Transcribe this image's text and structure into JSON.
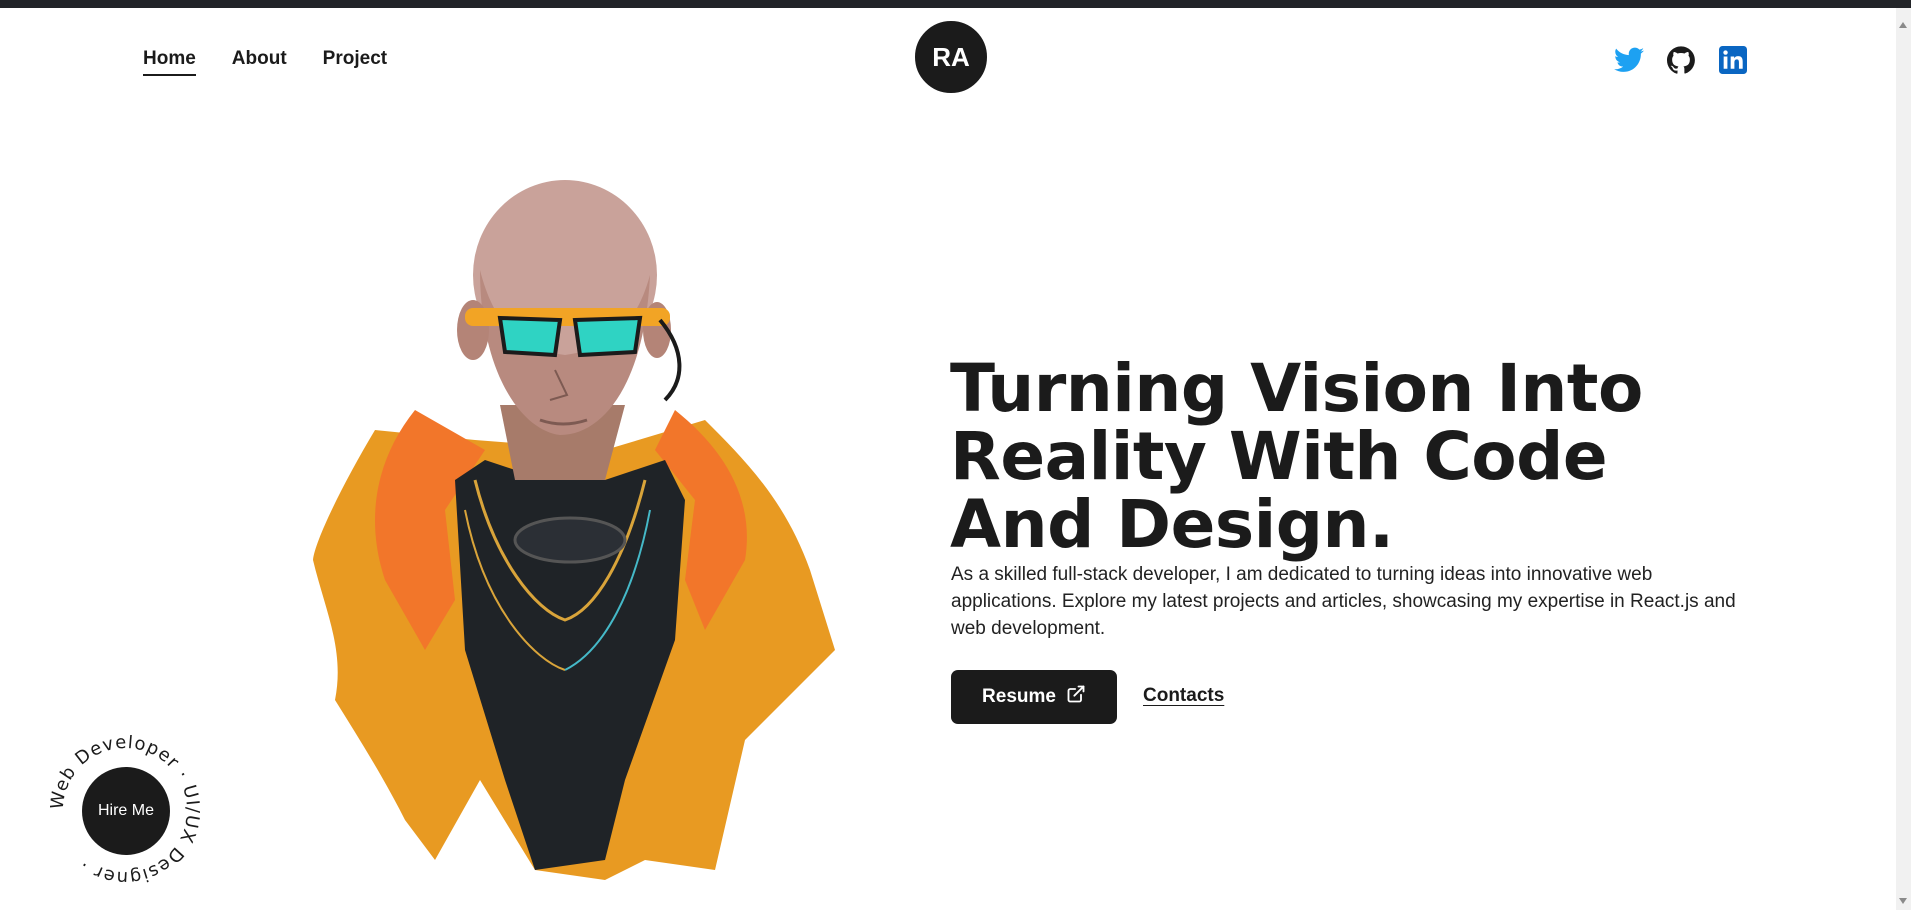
{
  "nav": {
    "items": [
      {
        "label": "Home",
        "active": true
      },
      {
        "label": "About",
        "active": false
      },
      {
        "label": "Project",
        "active": false
      }
    ]
  },
  "logo": {
    "initials": "RA"
  },
  "socials": {
    "icons": [
      "twitter-icon",
      "github-icon",
      "linkedin-icon"
    ],
    "colors": {
      "twitter": "#1DA1F2",
      "github": "#1b1b1b",
      "linkedin": "#0A66C2"
    }
  },
  "hero": {
    "headline_lines": [
      "Turning Vision Into",
      "Reality With Code",
      "And Design."
    ],
    "description": "As a skilled full-stack developer, I am dedicated to turning ideas into innovative web applications. Explore my latest projects and articles, showcasing my expertise in React.js and web development.",
    "resume_label": "Resume",
    "contacts_label": "Contacts"
  },
  "hire_badge": {
    "label": "Hire Me",
    "ring_text": "Web Developer · UI/UX Designer · "
  },
  "colors": {
    "dark": "#1b1b1b",
    "background": "#ffffff",
    "accent_orange": "#f08a1e",
    "accent_teal": "#2fd3c3"
  }
}
